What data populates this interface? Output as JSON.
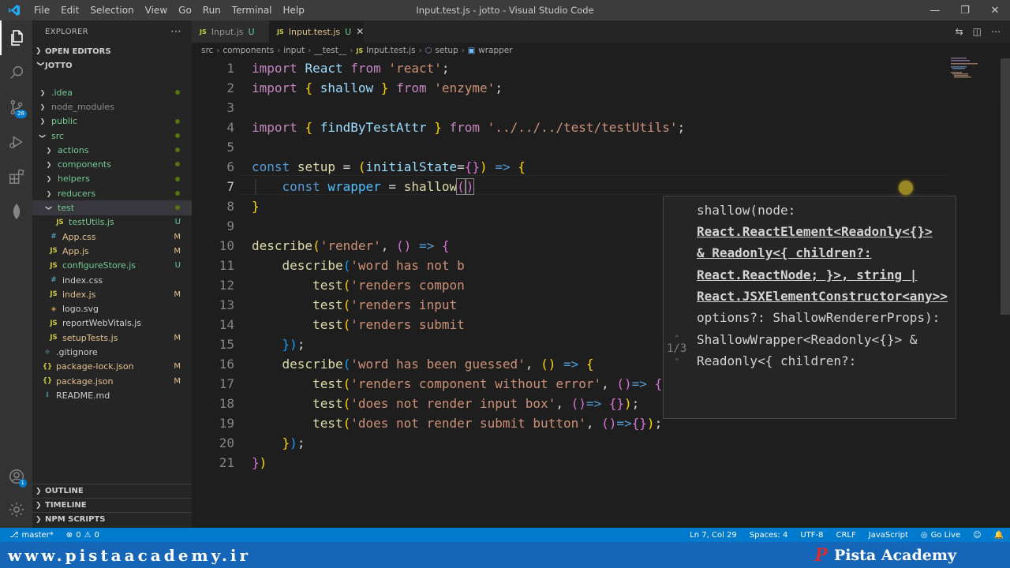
{
  "window": {
    "title": "Input.test.js - jotto - Visual Studio Code",
    "menu": [
      "File",
      "Edit",
      "Selection",
      "View",
      "Go",
      "Run",
      "Terminal",
      "Help"
    ]
  },
  "activity": {
    "scm_badge": "28",
    "accounts_badge": "1"
  },
  "sidebar": {
    "title": "EXPLORER",
    "open_editors": "OPEN EDITORS",
    "project": "JOTTO",
    "tree": [
      {
        "label": ".idea",
        "depth": 1,
        "type": "folder",
        "color": "#73c991"
      },
      {
        "label": "node_modules",
        "depth": 1,
        "type": "folder",
        "color": "#8c8c8c"
      },
      {
        "label": "public",
        "depth": 1,
        "type": "folder",
        "color": "#73c991"
      },
      {
        "label": "src",
        "depth": 1,
        "type": "folder-open",
        "color": "#73c991"
      },
      {
        "label": "actions",
        "depth": 2,
        "type": "folder",
        "color": "#73c991"
      },
      {
        "label": "components",
        "depth": 2,
        "type": "folder",
        "color": "#73c991"
      },
      {
        "label": "helpers",
        "depth": 2,
        "type": "folder",
        "color": "#73c991"
      },
      {
        "label": "reducers",
        "depth": 2,
        "type": "folder",
        "color": "#73c991"
      },
      {
        "label": "test",
        "depth": 2,
        "type": "folder-open",
        "color": "#73c991",
        "selected": true
      },
      {
        "label": "testUtils.js",
        "depth": 3,
        "type": "js",
        "color": "#73c991",
        "status": "U"
      },
      {
        "label": "App.css",
        "depth": 2,
        "type": "css",
        "color": "#e2c08d",
        "status": "M"
      },
      {
        "label": "App.js",
        "depth": 2,
        "type": "js",
        "color": "#e2c08d",
        "status": "M"
      },
      {
        "label": "configureStore.js",
        "depth": 2,
        "type": "js",
        "color": "#73c991",
        "status": "U"
      },
      {
        "label": "index.css",
        "depth": 2,
        "type": "css",
        "color": "#cccccc"
      },
      {
        "label": "index.js",
        "depth": 2,
        "type": "js",
        "color": "#e2c08d",
        "status": "M"
      },
      {
        "label": "logo.svg",
        "depth": 2,
        "type": "svg",
        "color": "#cccccc"
      },
      {
        "label": "reportWebVitals.js",
        "depth": 2,
        "type": "js",
        "color": "#cccccc"
      },
      {
        "label": "setupTests.js",
        "depth": 2,
        "type": "js",
        "color": "#e2c08d",
        "status": "M"
      },
      {
        "label": ".gitignore",
        "depth": 1,
        "type": "git",
        "color": "#cccccc"
      },
      {
        "label": "package-lock.json",
        "depth": 1,
        "type": "json",
        "color": "#e2c08d",
        "status": "M"
      },
      {
        "label": "package.json",
        "depth": 1,
        "type": "json",
        "color": "#e2c08d",
        "status": "M"
      },
      {
        "label": "README.md",
        "depth": 1,
        "type": "md",
        "color": "#cccccc"
      }
    ],
    "outline": "OUTLINE",
    "timeline": "TIMELINE",
    "npm_scripts": "NPM SCRIPTS"
  },
  "tabs": [
    {
      "label": "Input.js",
      "status": "U",
      "active": false
    },
    {
      "label": "Input.test.js",
      "status": "U",
      "active": true
    }
  ],
  "breadcrumb": [
    "src",
    "components",
    "input",
    "__test__",
    "Input.test.js",
    "setup",
    "wrapper"
  ],
  "editor": {
    "line_numbers": [
      "1",
      "2",
      "3",
      "4",
      "5",
      "6",
      "7",
      "8",
      "9",
      "10",
      "11",
      "12",
      "13",
      "14",
      "15",
      "16",
      "17",
      "18",
      "19",
      "20",
      "21"
    ],
    "code": {
      "l1_import": "import",
      "l1_react": "React",
      "l1_from": "from",
      "l1_str": "'react'",
      "l2_import": "import",
      "l2_name": "shallow",
      "l2_from": "from",
      "l2_str": "'enzyme'",
      "l4_import": "import",
      "l4_name": "findByTestAttr",
      "l4_from": "from",
      "l4_str": "'../../../test/testUtils'",
      "l6_const": "const",
      "l6_name": "setup",
      "l6_param": "initialState",
      "l7_const": "const",
      "l7_name": "wrapper",
      "l7_fn": "shallow",
      "l10_fn": "describe",
      "l10_str": "'render'",
      "l11_fn": "describe",
      "l11_str": "'word has not b",
      "l12_fn": "test",
      "l12_str": "'renders compon",
      "l13_fn": "test",
      "l13_str": "'renders input ",
      "l14_fn": "test",
      "l14_str": "'renders submit",
      "l16_fn": "describe",
      "l16_str": "'word has been guessed'",
      "l17_fn": "test",
      "l17_str": "'renders component without error'",
      "l18_fn": "test",
      "l18_str": "'does not render input box'",
      "l19_fn": "test",
      "l19_str": "'does not render submit button'"
    },
    "signature_help": {
      "lines": [
        "shallow(node:",
        "React.ReactElement<Readonly<{}>",
        "& Readonly<{ children?:",
        "React.ReactNode; }>, string |",
        "React.JSXElementConstructor<any>>",
        "options?: ShallowRendererProps):",
        "ShallowWrapper<Readonly<{}> &",
        "Readonly<{ children?:"
      ],
      "counter": "1/3"
    }
  },
  "statusbar": {
    "branch": "master*",
    "errors": "0",
    "warnings": "0",
    "position": "Ln 7, Col 29",
    "spaces": "Spaces: 4",
    "encoding": "UTF-8",
    "eol": "CRLF",
    "language": "JavaScript",
    "golive": "Go Live"
  },
  "watermark": {
    "url": "www.pistaacademy.ir",
    "brand": "Pista Academy"
  }
}
